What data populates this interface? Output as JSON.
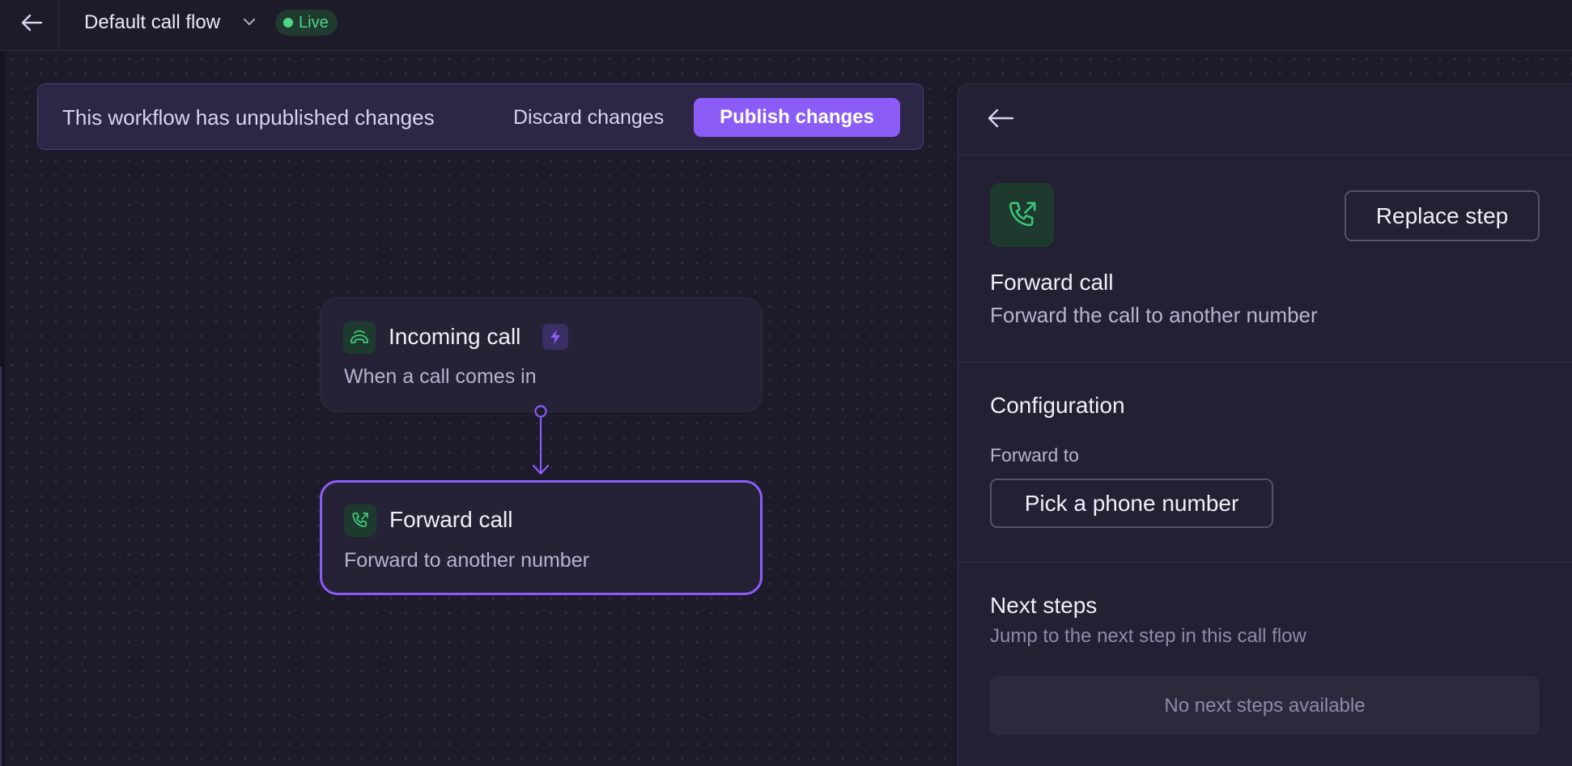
{
  "header": {
    "back_icon": "arrow-left-icon",
    "flow_title": "Default call flow",
    "flow_dropdown_icon": "chevron-down-icon",
    "status_badge": "Live",
    "status_color": "#4fd48a"
  },
  "banner": {
    "message": "This workflow has unpublished changes",
    "discard_label": "Discard changes",
    "publish_label": "Publish changes",
    "accent_color": "#8b5cf6"
  },
  "flow": {
    "nodes": [
      {
        "icon": "incoming-call-icon",
        "title": "Incoming call",
        "badge_icon": "lightning-icon",
        "subtitle": "When a call comes in"
      },
      {
        "icon": "forward-call-icon",
        "title": "Forward call",
        "subtitle": "Forward to another number",
        "selected": true
      }
    ]
  },
  "panel": {
    "back_icon": "arrow-left-icon",
    "step_icon": "forward-call-icon",
    "replace_label": "Replace step",
    "step_title": "Forward call",
    "step_description": "Forward the call to another number",
    "configuration": {
      "title": "Configuration",
      "field_label": "Forward to",
      "pick_label": "Pick a phone number"
    },
    "next_steps": {
      "title": "Next steps",
      "description": "Jump to the next step in this call flow",
      "empty_text": "No next steps available"
    }
  }
}
